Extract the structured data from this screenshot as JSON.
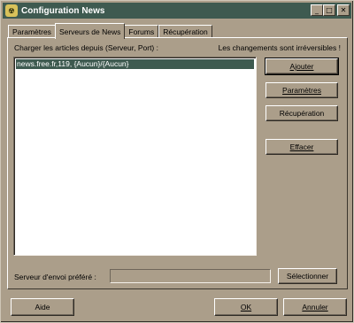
{
  "window": {
    "title": "Configuration News",
    "icon": "news-app-icon"
  },
  "title_controls": [
    {
      "name": "minimize-button",
      "glyph": "_"
    },
    {
      "name": "maximize-button",
      "glyph": "□"
    },
    {
      "name": "close-button",
      "glyph": "✕"
    }
  ],
  "tabs": [
    {
      "label": "Paramètres",
      "active": false
    },
    {
      "label": "Serveurs de News",
      "active": true
    },
    {
      "label": "Forums",
      "active": false
    },
    {
      "label": "Récupération",
      "active": false
    }
  ],
  "panel": {
    "load_label": "Charger les articles depuis (Serveur, Port) :",
    "warning": "Les changements sont irréversibles !",
    "servers": [
      "news.free.fr,119, {Aucun}/{Aucun}"
    ],
    "buttons": {
      "add": "Ajouter",
      "params": "Paramètres",
      "retrieve": "Récupération",
      "delete": "Effacer"
    },
    "send_server_label": "Serveur d'envoi préféré :",
    "send_server_value": "",
    "select": "Sélectionner"
  },
  "footer": {
    "help": "Aide",
    "ok": "OK",
    "cancel": "Annuler"
  },
  "colors": {
    "face": "#ab9e8a",
    "titlebar": "#3e5a50",
    "selection": "#3e5a50",
    "desktop": "#597c6c"
  }
}
